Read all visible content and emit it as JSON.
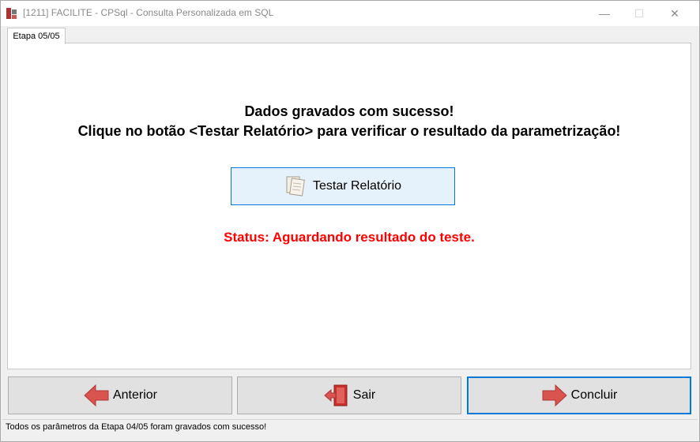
{
  "window": {
    "title": "[1211] FACILITE - CPSql - Consulta Personalizada em SQL",
    "minimize_glyph": "—",
    "maximize_glyph": "☐",
    "close_glyph": "✕"
  },
  "tab": {
    "label": "Etapa 05/05"
  },
  "content": {
    "message_line1": "Dados gravados com sucesso!",
    "message_line2": "Clique no botão <Testar Relatório> para verificar o resultado da parametrização!",
    "test_button_label": "Testar Relatório",
    "status_text": "Status: Aguardando resultado do teste."
  },
  "footer_buttons": {
    "anterior_label": "Anterior",
    "sair_label": "Sair",
    "concluir_label": "Concluir"
  },
  "statusbar": {
    "text": "Todos os parâmetros da Etapa 04/05 foram gravados com sucesso!"
  },
  "icons": {
    "app": "app-logo-icon",
    "test": "documents-icon",
    "anterior": "arrow-left-icon",
    "sair": "exit-door-icon",
    "concluir": "arrow-right-icon"
  },
  "colors": {
    "accent": "#0078d7",
    "status_red": "#ff0000",
    "arrow_red": "#d9534f"
  }
}
